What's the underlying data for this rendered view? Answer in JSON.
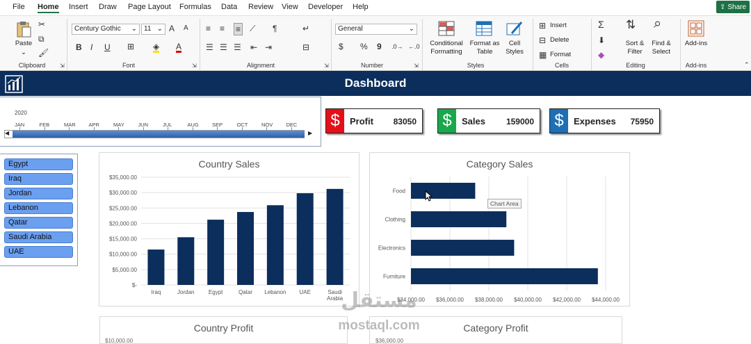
{
  "menu": {
    "items": [
      "File",
      "Home",
      "Insert",
      "Draw",
      "Page Layout",
      "Formulas",
      "Data",
      "Review",
      "View",
      "Developer",
      "Help"
    ],
    "active": "Home",
    "share": "Share"
  },
  "ribbon": {
    "clipboard": {
      "paste": "Paste",
      "label": "Clipboard"
    },
    "font": {
      "name": "Century Gothic",
      "size": "11",
      "label": "Font",
      "bold": "B",
      "italic": "I",
      "underline": "U",
      "grow": "A",
      "shrink": "A",
      "color": "A"
    },
    "alignment": {
      "label": "Alignment"
    },
    "number": {
      "format": "General",
      "label": "Number",
      "currency": "$",
      "percent": "%",
      "comma": "9"
    },
    "styles": {
      "conditional_1": "Conditional",
      "conditional_2": "Formatting",
      "format_as_table_1": "Format as",
      "format_as_table_2": "Table",
      "cell_styles_1": "Cell",
      "cell_styles_2": "Styles",
      "label": "Styles"
    },
    "cells": {
      "insert": "Insert",
      "delete": "Delete",
      "format": "Format",
      "label": "Cells"
    },
    "editing": {
      "sort_1": "Sort &",
      "sort_2": "Filter",
      "find_1": "Find &",
      "find_2": "Select",
      "label": "Editing",
      "sum": "Σ"
    },
    "addins": {
      "button": "Add-ins",
      "label": "Add-ins"
    }
  },
  "dashboard": {
    "title": "Dashboard"
  },
  "timeline": {
    "year": "2020",
    "months": [
      "JAN",
      "FEB",
      "MAR",
      "APR",
      "MAY",
      "JUN",
      "JUL",
      "AUG",
      "SEP",
      "OCT",
      "NOV",
      "DEC"
    ]
  },
  "kpis": [
    {
      "label": "Profit",
      "value": "83050",
      "color": "#e3101a",
      "symbol": "$"
    },
    {
      "label": "Sales",
      "value": "159000",
      "color": "#1aa84c",
      "symbol": "$"
    },
    {
      "label": "Expenses",
      "value": "75950",
      "color": "#1f6fb5",
      "symbol": "$"
    }
  ],
  "slicer": {
    "items": [
      "Egypt",
      "Iraq",
      "Jordan",
      "Lebanon",
      "Qatar",
      "Saudi Arabia",
      "UAE"
    ]
  },
  "chart_data": [
    {
      "type": "bar",
      "title": "Country Sales",
      "categories": [
        "Iraq",
        "Jordan",
        "Egypt",
        "Qatar",
        "Lebanon",
        "UAE",
        "Saudi Arabia"
      ],
      "values": [
        11500,
        15500,
        21200,
        23700,
        25900,
        29800,
        31200
      ],
      "ylim": [
        0,
        35000
      ],
      "yticks": [
        "$-",
        "$5,000.00",
        "$10,000.00",
        "$15,000.00",
        "$20,000.00",
        "$25,000.00",
        "$30,000.00",
        "$35,000.00"
      ],
      "color": "#0b2e5c",
      "grid": true
    },
    {
      "type": "bar",
      "orientation": "horizontal",
      "title": "Category Sales",
      "categories": [
        "Food",
        "Clothing",
        "Electronics",
        "Furniture"
      ],
      "values": [
        37300,
        38900,
        39300,
        43600
      ],
      "xlim": [
        34000,
        44000
      ],
      "xticks": [
        "$34,000.00",
        "$36,000.00",
        "$38,000.00",
        "$40,000.00",
        "$42,000.00",
        "$44,000.00"
      ],
      "color": "#0b2e5c",
      "grid": true,
      "tooltip": "Chart Area"
    },
    {
      "type": "bar",
      "title": "Country Profit",
      "first_tick": "$10,000.00"
    },
    {
      "type": "bar",
      "title": "Category Profit",
      "first_tick": "$36,000.00"
    }
  ],
  "watermark": {
    "arabic": "مستقل",
    "latin": "mostaql.com"
  }
}
